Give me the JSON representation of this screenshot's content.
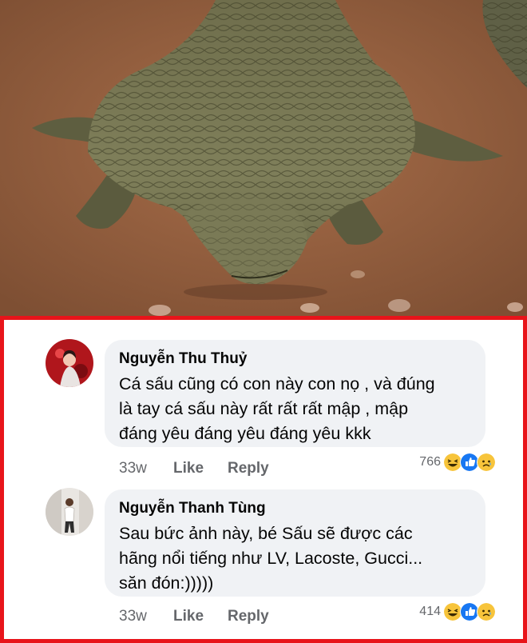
{
  "comments": [
    {
      "author": "Nguyễn Thu Thuỷ",
      "lines": [
        "Cá sấu cũng có con này con nọ , và đúng",
        "là tay cá sấu này rất rất rất mập , mập",
        "đáng yêu đáng yêu đáng yêu kkk"
      ],
      "time": "33w",
      "like_label": "Like",
      "reply_label": "Reply",
      "reaction_count": "766",
      "reaction_icons": [
        "haha-icon",
        "like-icon",
        "sad-icon"
      ]
    },
    {
      "author": "Nguyễn Thanh Tùng",
      "lines": [
        "Sau bức ảnh này, bé Sấu sẽ được các",
        "hãng nổi tiếng như LV, Lacoste, Gucci...",
        "săn đón:)))))"
      ],
      "time": "33w",
      "like_label": "Like",
      "reply_label": "Reply",
      "reaction_count": "414",
      "reaction_icons": [
        "haha-icon",
        "like-icon",
        "sad-icon"
      ]
    }
  ],
  "colors": {
    "frame_border": "#e8141a",
    "bubble_bg": "#f0f2f5",
    "meta_text": "#65676b",
    "like_blue": "#1877f2",
    "haha_yellow": "#f7c43b"
  }
}
